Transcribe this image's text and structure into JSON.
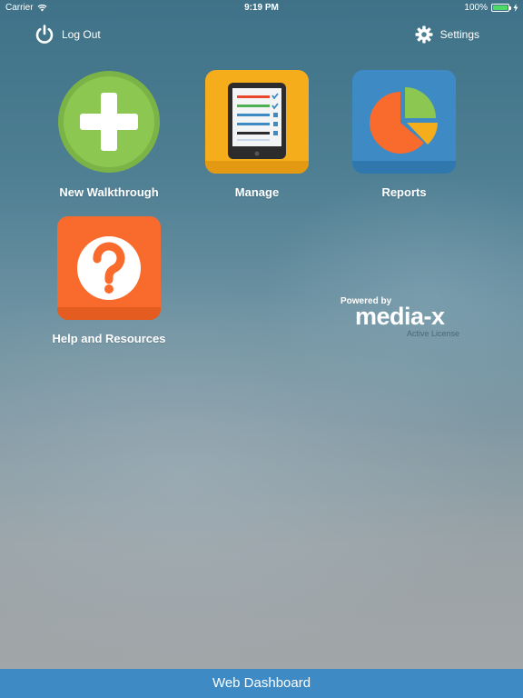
{
  "status_bar": {
    "carrier": "Carrier",
    "time": "9:19 PM",
    "battery": "100%",
    "battery_level": 1.0,
    "wifi_icon": "wifi-icon",
    "charging_icon": "bolt-icon"
  },
  "header": {
    "logout_label": "Log Out",
    "logout_icon": "power-icon",
    "settings_label": "Settings",
    "settings_icon": "gear-icon"
  },
  "tiles": [
    {
      "label": "New Walkthrough",
      "icon": "plus-circle-icon",
      "color": "#8cc751"
    },
    {
      "label": "Manage",
      "icon": "tablet-checklist-icon",
      "color": "#f5ad1c"
    },
    {
      "label": "Reports",
      "icon": "pie-chart-icon",
      "color": "#3d8ac4"
    },
    {
      "label": "Help and Resources",
      "icon": "question-circle-icon",
      "color": "#f96a2d"
    }
  ],
  "branding": {
    "powered_by": "Powered by",
    "brand": "media-x",
    "license": "Active License"
  },
  "footer": {
    "web_dashboard_label": "Web Dashboard"
  }
}
